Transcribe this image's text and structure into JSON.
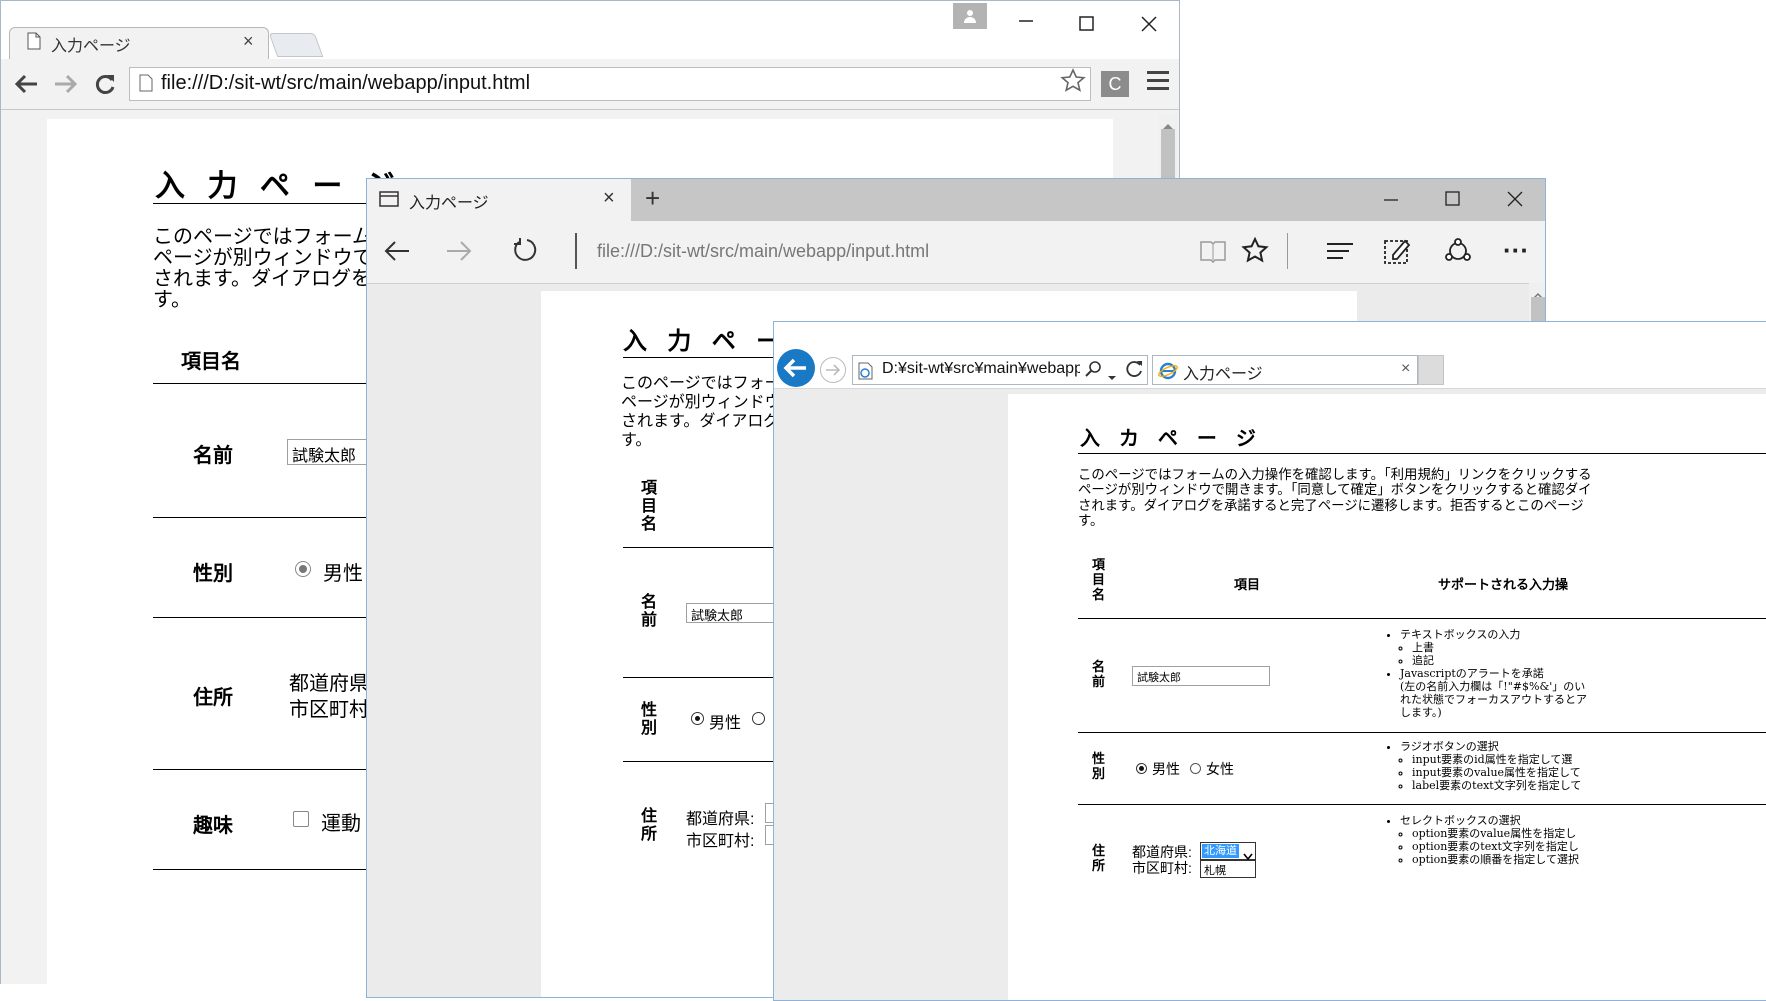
{
  "chrome": {
    "tab_title": "入力ページ",
    "tab_close": "×",
    "address": "file:///D:/sit-wt/src/main/webapp/input.html",
    "ext_label": "C",
    "page": {
      "heading": "入 力 ペ ー ジ",
      "intro": [
        "このページではフォーム",
        "ページが別ウィンドウで",
        "されます。ダイアログを",
        "す。"
      ],
      "col_item": "項目名",
      "rows": {
        "name": "名前",
        "gender": "性別",
        "address": "住所",
        "hobby": "趣味"
      },
      "name_value": "試験太郎",
      "male": "男性",
      "pref_label": "都道府県",
      "city_label": "市区町村",
      "hobby_option": "運動"
    }
  },
  "edge": {
    "tab_title": "入力ページ",
    "tab_close": "×",
    "new_tab": "+",
    "address": "file:///D:/sit-wt/src/main/webapp/input.html",
    "more": "···",
    "page": {
      "heading": "入 力 ペ ー ジ",
      "intro": [
        "このページではフォー",
        "ページが別ウィンドウ",
        "されます。ダイアログを",
        "す。"
      ],
      "col_item": [
        "項",
        "目",
        "名"
      ],
      "name_label": [
        "名",
        "前"
      ],
      "gender_label": [
        "性",
        "別"
      ],
      "address_label": [
        "住",
        "所"
      ],
      "name_value": "試験太郎",
      "male": "男性",
      "pref_label": "都道府県:",
      "city_label": "市区町村:"
    }
  },
  "ie": {
    "address": "D:¥sit-wt¥src¥main¥webapp",
    "tab_title": "入力ページ",
    "tab_close": "×",
    "page": {
      "heading": "入 カ ペ ー ジ",
      "intro": [
        "このページではフォームの入力操作を確認します。「利用規約」リンクをクリックする",
        "ページが別ウィンドウで開きます。「同意して確定」ボタンをクリックすると確認ダイ",
        "されます。ダイアログを承諾すると完了ページに遷移します。拒否するとこのページ",
        "す。"
      ],
      "col_item_name": [
        "項",
        "目",
        "名"
      ],
      "col_item": "項目",
      "col_support": "サポートされる入力操",
      "name_label": [
        "名",
        "前"
      ],
      "gender_label": [
        "性",
        "別"
      ],
      "address_label": [
        "住",
        "所"
      ],
      "name_value": "試験太郎",
      "male": "男性",
      "female": "女性",
      "pref_label": "都道府県:",
      "city_label": "市区町村:",
      "pref_value": "北海道",
      "city_value": "札幌",
      "support_name": {
        "item1": "テキストボックスの入力",
        "sub1": "上書",
        "sub2": "追記",
        "item2": "Javascriptのアラートを承諾",
        "note1": "(左の名前入力欄は「!\"#$%&'」のい",
        "note2": "れた状態でフォーカスアウトするとア",
        "note3": "します。)"
      },
      "support_gender": {
        "item": "ラジオボタンの選択",
        "sub1": "input要素のid属性を指定して選",
        "sub2": "input要素のvalue属性を指定して",
        "sub3": "label要素のtext文字列を指定して"
      },
      "support_address": {
        "item": "セレクトボックスの選択",
        "sub1": "option要素のvalue属性を指定し",
        "sub2": "option要素のtext文字列を指定し",
        "sub3": "option要素の順番を指定して選択"
      }
    }
  }
}
